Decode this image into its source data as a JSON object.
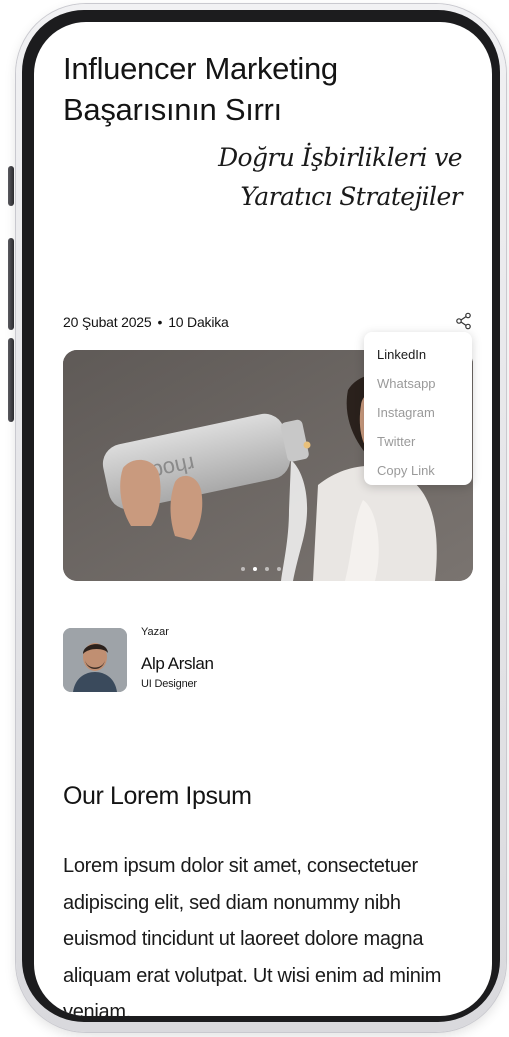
{
  "article": {
    "title": "Influencer Marketing Başarısının Sırrı",
    "subtitle": "Doğru İşbirlikleri ve Yaratıcı Stratejiler",
    "date": "20 Şubat 2025",
    "separator": "•",
    "read_time": "10 Dakika",
    "image_label": "rhode"
  },
  "share_menu": {
    "icon": "share-icon",
    "options": [
      "LinkedIn",
      "Whatsapp",
      "Instagram",
      "Twitter",
      "Copy Link"
    ]
  },
  "carousel": {
    "count": 4,
    "active_index": 1
  },
  "author": {
    "role": "Yazar",
    "name": "Alp Arslan",
    "title": "UI Designer"
  },
  "section": {
    "heading": "Our Lorem Ipsum",
    "body": "Lorem ipsum dolor sit amet, consectetuer adipiscing elit, sed diam nonummy nibh euismod tincidunt ut laoreet dolore magna aliquam erat volutpat. Ut wisi enim ad minim veniam,"
  },
  "colors": {
    "text": "#141414",
    "muted": "#9a9a9a",
    "frame": "#1c1c1e",
    "background": "#ffffff"
  }
}
